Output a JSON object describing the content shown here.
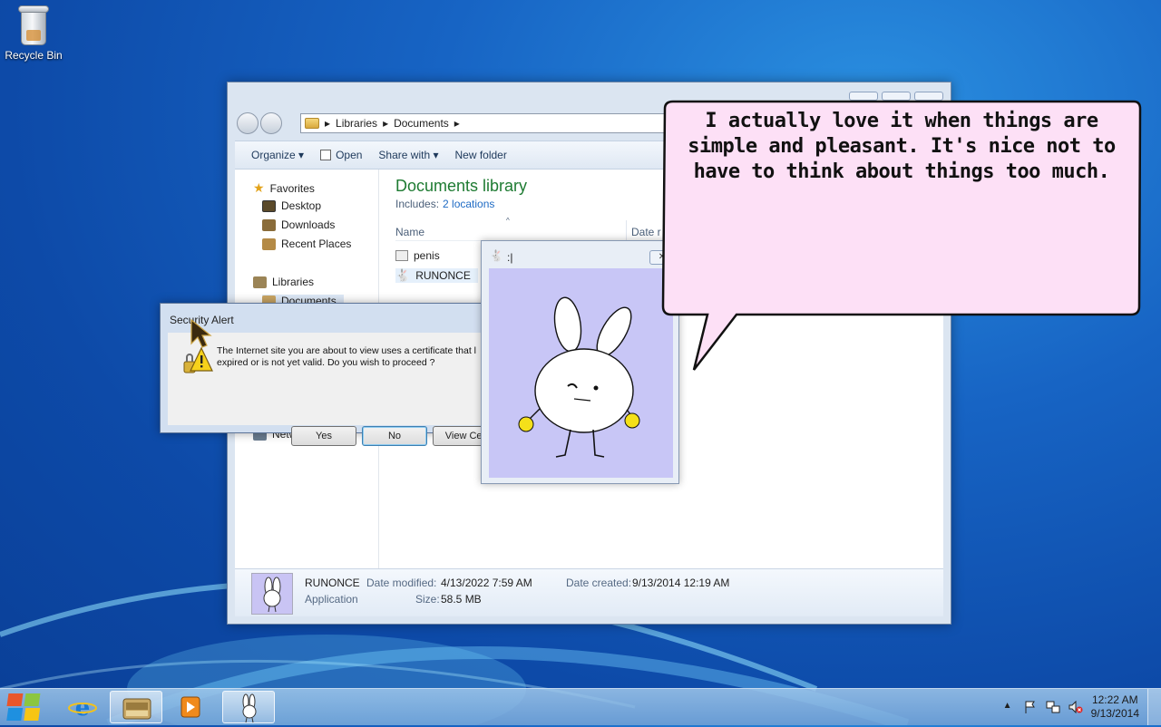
{
  "desktop": {
    "icons": [
      {
        "label": "Recycle Bin",
        "icon": "recycle-bin-icon"
      }
    ]
  },
  "explorer": {
    "breadcrumb": [
      "Libraries",
      "Documents"
    ],
    "toolbar": {
      "organize": "Organize",
      "open": "Open",
      "share_with": "Share with",
      "new_folder": "New folder"
    },
    "nav": {
      "favorites": "Favorites",
      "desktop": "Desktop",
      "downloads": "Downloads",
      "recent_places": "Recent Places",
      "libraries": "Libraries",
      "documents": "Documents",
      "network": "Network"
    },
    "library_title": "Documents library",
    "includes_label": "Includes:",
    "includes_link": "2 locations",
    "columns": {
      "name": "Name",
      "date": "Date r"
    },
    "files": [
      {
        "name": "penis"
      },
      {
        "name": "RUNONCE"
      }
    ],
    "details": {
      "name": "RUNONCE",
      "type": "Application",
      "date_modified_label": "Date modified:",
      "date_modified": "4/13/2022 7:59 AM",
      "size_label": "Size:",
      "size": "58.5 MB",
      "date_created_label": "Date created:",
      "date_created": "9/13/2014 12:19 AM"
    }
  },
  "security_alert": {
    "title": "Security Alert",
    "message": "The Internet site you are about to view uses a certificate that l expired or is not yet valid. Do you wish to proceed ?",
    "buttons": {
      "yes": "Yes",
      "no": "No",
      "view": "View Cer"
    }
  },
  "bunny_window": {
    "title": ":|"
  },
  "speech_bubble": {
    "text": "I actually love it when things are simple and pleasant. It's nice not to have to think about things too much."
  },
  "taskbar": {
    "items": [
      "internet-explorer-icon",
      "file-explorer-icon",
      "media-player-icon",
      "bunny-app-icon"
    ],
    "clock": {
      "time": "12:22 AM",
      "date": "9/13/2014"
    }
  },
  "colors": {
    "library_title": "#1e7b32",
    "link": "#1f6bc4",
    "bubble_fill": "#fde0f6",
    "bunny_bg": "#c8c6f6"
  }
}
